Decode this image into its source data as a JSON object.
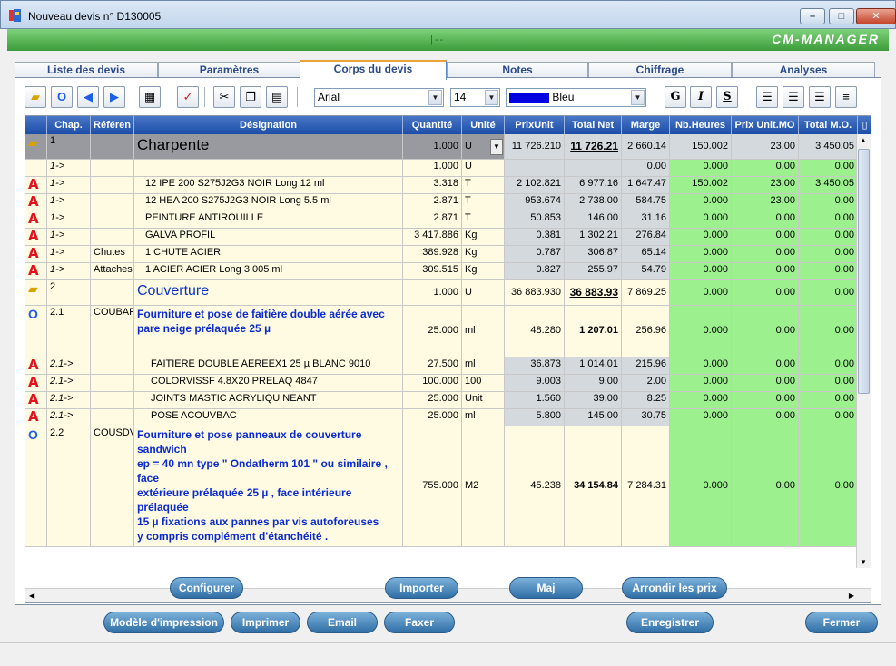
{
  "window": {
    "title": "Nouveau devis n° D130005",
    "minimize": "–",
    "maximize": "□",
    "close": "✕"
  },
  "header": {
    "mid": "|--",
    "brand": "CM-MANAGER"
  },
  "tabs": [
    "Liste des devis",
    "Paramètres",
    "Corps du devis",
    "Notes",
    "Chiffrage",
    "Analyses"
  ],
  "toolbar": {
    "font": "Arial",
    "size": "14",
    "color": "Bleu",
    "bold": "G",
    "italic": "I",
    "underline": "S"
  },
  "columns": [
    "Chap.",
    "Référen",
    "Désignation",
    "Quantité",
    "Unité",
    "PrixUnit",
    "Total Net",
    "Marge",
    "Nb.Heures",
    "Prix Unit.MO",
    "Total M.O."
  ],
  "rows": [
    {
      "icon": "folder",
      "chap": "1",
      "ref": "",
      "des": "Charpente",
      "qty": "1.000",
      "unit": "U",
      "pu": "11 726.210",
      "tn": "11 726.21",
      "mg": "2 660.14",
      "nh": "150.002",
      "pmo": "23.00",
      "tmo": "3 450.05"
    },
    {
      "icon": "",
      "chap": "1->",
      "ref": "",
      "des": "",
      "qty": "1.000",
      "unit": "U",
      "pu": "",
      "tn": "",
      "mg": "0.00",
      "nh": "0.000",
      "pmo": "0.00",
      "tmo": "0.00"
    },
    {
      "icon": "A",
      "chap": "1->",
      "ref": "",
      "des": "12  IPE 200 S275J2G3 NOIR  Long  12 ml",
      "qty": "3.318",
      "unit": "T",
      "pu": "2 102.821",
      "tn": "6 977.16",
      "mg": "1 647.47",
      "nh": "150.002",
      "pmo": "23.00",
      "tmo": "3 450.05"
    },
    {
      "icon": "A",
      "chap": "1->",
      "ref": "",
      "des": "12  HEA 200 S275J2G3 NOIR  Long  5.5 ml",
      "qty": "2.871",
      "unit": "T",
      "pu": "953.674",
      "tn": "2 738.00",
      "mg": "584.75",
      "nh": "0.000",
      "pmo": "23.00",
      "tmo": "0.00"
    },
    {
      "icon": "A",
      "chap": "1->",
      "ref": "",
      "des": "PEINTURE ANTIROUILLE",
      "qty": "2.871",
      "unit": "T",
      "pu": "50.853",
      "tn": "146.00",
      "mg": "31.16",
      "nh": "0.000",
      "pmo": "0.00",
      "tmo": "0.00"
    },
    {
      "icon": "A",
      "chap": "1->",
      "ref": "",
      "des": "GALVA PROFIL",
      "qty": "3 417.886",
      "unit": "Kg",
      "pu": "0.381",
      "tn": "1 302.21",
      "mg": "276.84",
      "nh": "0.000",
      "pmo": "0.00",
      "tmo": "0.00"
    },
    {
      "icon": "A",
      "chap": "1->",
      "ref": "Chutes",
      "des": "1  CHUTE ACIER",
      "qty": "389.928",
      "unit": "Kg",
      "pu": "0.787",
      "tn": "306.87",
      "mg": "65.14",
      "nh": "0.000",
      "pmo": "0.00",
      "tmo": "0.00"
    },
    {
      "icon": "A",
      "chap": "1->",
      "ref": "Attaches",
      "des": "1  ACIER ACIER   Long  3.005 ml",
      "qty": "309.515",
      "unit": "Kg",
      "pu": "0.827",
      "tn": "255.97",
      "mg": "54.79",
      "nh": "0.000",
      "pmo": "0.00",
      "tmo": "0.00"
    },
    {
      "icon": "folder",
      "chap": "2",
      "ref": "",
      "des": "Couverture",
      "qty": "1.000",
      "unit": "U",
      "pu": "36 883.930",
      "tn": "36 883.93",
      "mg": "7 869.25",
      "nh": "0.000",
      "pmo": "0.00",
      "tmo": "0.00"
    },
    {
      "icon": "O",
      "chap": "2.1",
      "ref": "COUBAF.",
      "des": "Fourniture et pose de faitière double aérée avec\npare neige prélaquée 25 µ",
      "qty": "25.000",
      "unit": "ml",
      "pu": "48.280",
      "tn": "1 207.01",
      "mg": "256.96",
      "nh": "0.000",
      "pmo": "0.00",
      "tmo": "0.00"
    },
    {
      "icon": "A",
      "chap": "2.1->",
      "ref": "",
      "des": "FAITIERE DOUBLE AEREEX1 25 µ BLANC 9010",
      "qty": "27.500",
      "unit": "ml",
      "pu": "36.873",
      "tn": "1 014.01",
      "mg": "215.96",
      "nh": "0.000",
      "pmo": "0.00",
      "tmo": "0.00"
    },
    {
      "icon": "A",
      "chap": "2.1->",
      "ref": "",
      "des": "COLORVISSF 4.8X20 PRELAQ 4847",
      "qty": "100.000",
      "unit": "100",
      "pu": "9.003",
      "tn": "9.00",
      "mg": "2.00",
      "nh": "0.000",
      "pmo": "0.00",
      "tmo": "0.00"
    },
    {
      "icon": "A",
      "chap": "2.1->",
      "ref": "",
      "des": "JOINTS MASTIC ACRYLIQU NEANT",
      "qty": "25.000",
      "unit": "Unit",
      "pu": "1.560",
      "tn": "39.00",
      "mg": "8.25",
      "nh": "0.000",
      "pmo": "0.00",
      "tmo": "0.00"
    },
    {
      "icon": "A",
      "chap": "2.1->",
      "ref": "",
      "des": "POSE ACOUVBAC",
      "qty": "25.000",
      "unit": "ml",
      "pu": "5.800",
      "tn": "145.00",
      "mg": "30.75",
      "nh": "0.000",
      "pmo": "0.00",
      "tmo": "0.00"
    },
    {
      "icon": "O",
      "chap": "2.2",
      "ref": "COUSDV",
      "des": "Fourniture et pose panneaux de couverture sandwich\nep = 40 mn type \" Ondatherm 101 \" ou similaire , face\nextérieure prélaquée 25 µ , face intérieure prélaquée\n15 µ fixations aux pannes par vis autoforeuses\ny compris complément d'étanchéité .",
      "qty": "755.000",
      "unit": "M2",
      "pu": "45.238",
      "tn": "34 154.84",
      "mg": "7 284.31",
      "nh": "0.000",
      "pmo": "0.00",
      "tmo": "0.00"
    }
  ],
  "buttons1": [
    "Configurer",
    "Importer",
    "Maj",
    "Arrondir les prix"
  ],
  "buttons2": [
    "Modèle d'impression",
    "Imprimer",
    "Email",
    "Faxer",
    "Enregistrer",
    "Fermer"
  ]
}
